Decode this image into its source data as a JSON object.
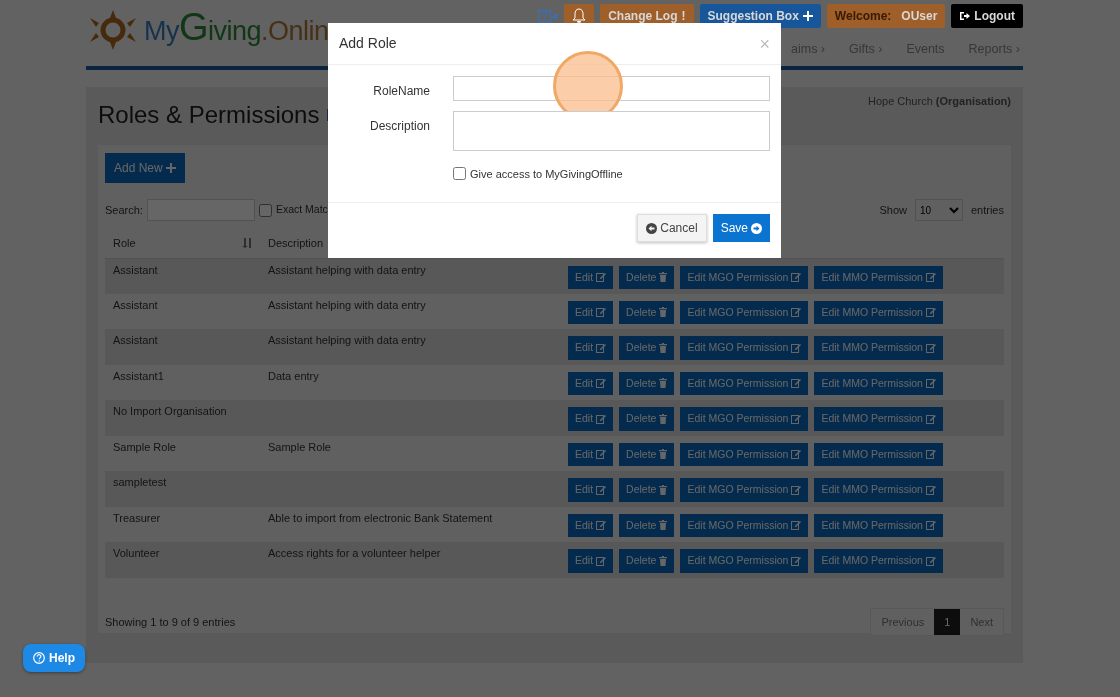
{
  "header": {
    "logo": "MyGiving.Onlin",
    "top_bar": [
      {
        "kind": "video-help"
      },
      {
        "kind": "bell",
        "color": "#9e5f2a"
      },
      {
        "kind": "changelog",
        "label": "Change Log",
        "glyph": "!",
        "color": "#9e5f2a"
      },
      {
        "kind": "suggestion",
        "label": "Suggestion Box",
        "color": "#17569a"
      },
      {
        "kind": "welcome",
        "label": "Welcome:",
        "user": "OUser",
        "color": "#9e5f2a"
      },
      {
        "kind": "logout",
        "label": "Logout",
        "color": "#000000"
      }
    ],
    "nav": [
      "aims ›",
      "Gifts ›",
      "Events",
      "Reports ›"
    ]
  },
  "page": {
    "title": "Roles & Permissions",
    "organisation": "Hope Church **(Organisation)**",
    "add_button": "Add New",
    "search": {
      "label": "Search:"
    },
    "exact_match": {
      "label": "Exact Matc",
      "checked": false
    },
    "show": {
      "label": "Show",
      "value": "10",
      "suffix": "entries"
    },
    "table": {
      "columns": [
        "Role",
        "Description"
      ],
      "rows": [
        {
          "role": "Assistant",
          "description": "Assistant helping with data entry",
          "actions": [
            "Edit",
            "Delete",
            "Edit MGO Permission",
            "Edit MMO Permission"
          ]
        },
        {
          "role": "Assistant",
          "description": "Assistant helping with data entry",
          "actions": [
            "Edit",
            "Delete",
            "Edit MGO Permission",
            "Edit MMO Permission"
          ]
        },
        {
          "role": "Assistant",
          "description": "Assistant helping with data entry",
          "actions": [
            "Edit",
            "Delete",
            "Edit MGO Permission",
            "Edit MMO Permission"
          ]
        },
        {
          "role": "Assistant1",
          "description": "Data entry",
          "actions": [
            "Edit",
            "Delete",
            "Edit MGO Permission",
            "Edit MMO Permission"
          ]
        },
        {
          "role": "No Import Organisation",
          "actions": [
            "Edit",
            "Delete",
            "Edit MGO Permission",
            "Edit MMO Permission"
          ]
        },
        {
          "role": "Sample Role",
          "description": "Sample Role",
          "actions": [
            "Edit",
            "Delete",
            "Edit MGO Permission",
            "Edit MMO Permission"
          ]
        },
        {
          "role": "sampletest",
          "actions": [
            "Edit",
            "Delete",
            "Edit MGO Permission",
            "Edit MMO Permission"
          ]
        },
        {
          "role": "Treasurer",
          "description": "Able to import from electronic Bank Statement",
          "actions": [
            "Edit",
            "Delete",
            "Edit MGO Permission",
            "Edit MMO Permission"
          ]
        },
        {
          "role": "Volunteer",
          "description": "Access rights for a volunteer helper",
          "actions": [
            "Edit",
            "Delete",
            "Edit MGO Permission",
            "Edit MMO Permission"
          ]
        }
      ]
    },
    "info": "Showing 1 to 9 of 9 entries",
    "pagination": [
      {
        "label": "Previous",
        "selected": false
      },
      {
        "label": "1",
        "selected": true
      },
      {
        "label": "Next",
        "selected": false
      }
    ]
  },
  "modal": {
    "title": "Add Role",
    "close": "×",
    "fields": [
      {
        "label": "RoleName",
        "kind": "input",
        "highlighted": true
      },
      {
        "label": "Description",
        "kind": "textarea",
        "highlighted": false
      }
    ],
    "checkbox": {
      "label": "Give access to MyGivingOffline",
      "checked": false
    },
    "buttons": [
      {
        "label": "Cancel",
        "kind": "cancel"
      },
      {
        "label": "Save",
        "kind": "save"
      }
    ]
  },
  "help": {
    "label": "Help"
  }
}
